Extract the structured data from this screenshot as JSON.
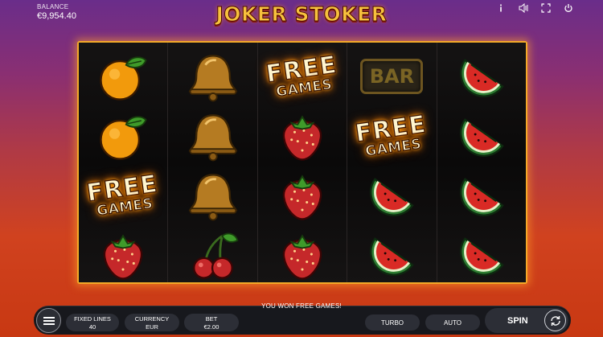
{
  "balance": {
    "label": "BALANCE",
    "value": "€9,954.40"
  },
  "logo": {
    "text": "JOKER STOKER"
  },
  "top_icons": [
    "info-icon",
    "sound-icon",
    "fullscreen-icon",
    "power-icon"
  ],
  "reels": [
    [
      "orange",
      "orange",
      "free-games",
      "strawberry"
    ],
    [
      "bell",
      "bell",
      "bell",
      "cherries"
    ],
    [
      "free-games",
      "strawberry",
      "strawberry",
      "strawberry"
    ],
    [
      "bar",
      "free-games",
      "watermelon",
      "watermelon"
    ],
    [
      "watermelon",
      "watermelon",
      "watermelon",
      "watermelon"
    ]
  ],
  "free_games": {
    "line1": "FREE",
    "line2": "GAMES"
  },
  "bar_symbol": {
    "text": "BAR"
  },
  "bottom": {
    "win_message": "YOU WON FREE GAMES!",
    "fixed_lines": {
      "label": "FIXED LINES",
      "value": "40"
    },
    "currency": {
      "label": "CURRENCY",
      "value": "EUR"
    },
    "bet": {
      "label": "BET",
      "value": "€2.00"
    },
    "turbo": "TURBO",
    "auto": "AUTO",
    "spin": "SPIN"
  },
  "colors": {
    "frame": "#f4a928",
    "reel_bg": "#0c0b0b",
    "bar_bg": "#17181d",
    "logo": "#f7c13c"
  }
}
